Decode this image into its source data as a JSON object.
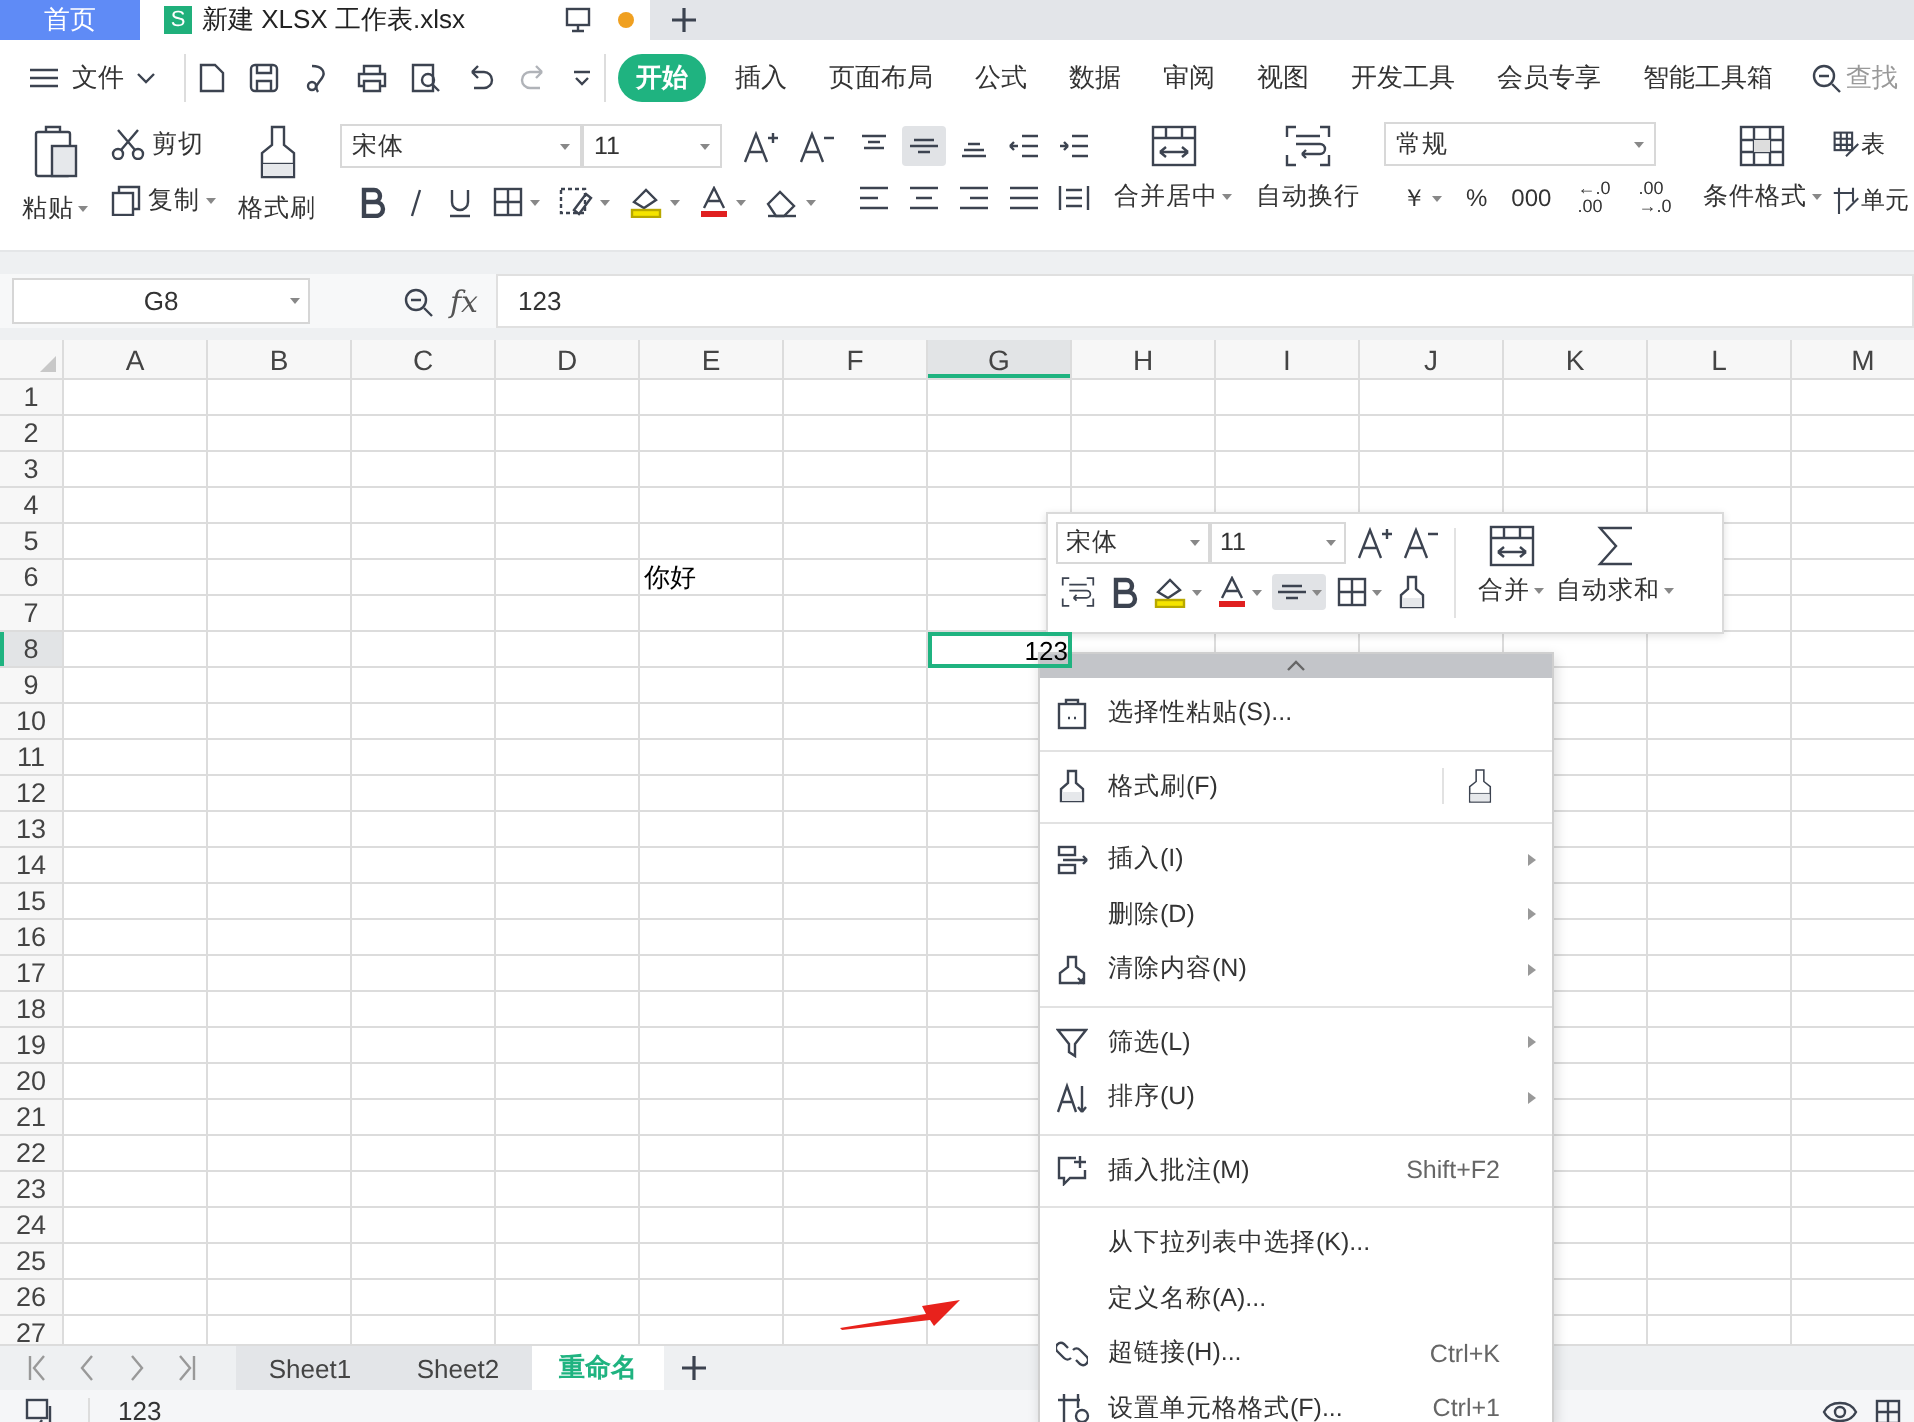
{
  "tab_bar": {
    "home_tab": "首页",
    "document_tab": {
      "badge": "S",
      "title": "新建 XLSX 工作表.xlsx",
      "unsaved": true
    }
  },
  "menu_bar": {
    "file_menu": "文件",
    "tabs": [
      {
        "label": "开始",
        "selected": true
      },
      {
        "label": "插入",
        "selected": false
      },
      {
        "label": "页面布局",
        "selected": false
      },
      {
        "label": "公式",
        "selected": false
      },
      {
        "label": "数据",
        "selected": false
      },
      {
        "label": "审阅",
        "selected": false
      },
      {
        "label": "视图",
        "selected": false
      },
      {
        "label": "开发工具",
        "selected": false
      },
      {
        "label": "会员专享",
        "selected": false
      },
      {
        "label": "智能工具箱",
        "selected": false
      }
    ],
    "search": "查找"
  },
  "ribbon": {
    "paste": "粘贴",
    "cut": "剪切",
    "copy": "复制",
    "format_painter": "格式刷",
    "font_name": "宋体",
    "font_size": "11",
    "vertical_align": [
      {
        "selected": false
      },
      {
        "selected": true
      },
      {
        "selected": false
      }
    ],
    "merge_center": "合并居中",
    "wrap_text": "自动换行",
    "number_format": "常规",
    "currency": "￥",
    "percent": "%",
    "thousands": "000",
    "increase_decimal": [
      "←.0",
      ".00"
    ],
    "decrease_decimal": [
      ".00",
      "→.0"
    ],
    "conditional_format": "条件格式",
    "table_style": "表",
    "cell_style": "单元"
  },
  "formula_bar": {
    "name_box": "G8",
    "function_label": "fx",
    "value": "123"
  },
  "sheet": {
    "columns": [
      {
        "label": "A",
        "selected": false
      },
      {
        "label": "B",
        "selected": false
      },
      {
        "label": "C",
        "selected": false
      },
      {
        "label": "D",
        "selected": false
      },
      {
        "label": "E",
        "selected": false
      },
      {
        "label": "F",
        "selected": false
      },
      {
        "label": "G",
        "selected": true
      },
      {
        "label": "H",
        "selected": false
      },
      {
        "label": "I",
        "selected": false
      },
      {
        "label": "J",
        "selected": false
      },
      {
        "label": "K",
        "selected": false
      },
      {
        "label": "L",
        "selected": false
      },
      {
        "label": "M",
        "selected": false
      }
    ],
    "rows": [
      {
        "label": "1",
        "selected": false
      },
      {
        "label": "2",
        "selected": false
      },
      {
        "label": "3",
        "selected": false
      },
      {
        "label": "4",
        "selected": false
      },
      {
        "label": "5",
        "selected": false
      },
      {
        "label": "6",
        "selected": false,
        "cells": [
          null,
          null,
          null,
          null,
          {
            "value": "你好",
            "selected": false
          }
        ]
      },
      {
        "label": "7",
        "selected": false
      },
      {
        "label": "8",
        "selected": true,
        "cells": [
          null,
          null,
          null,
          null,
          null,
          null,
          {
            "value": "123",
            "selected": true
          }
        ]
      },
      {
        "label": "9",
        "selected": false
      },
      {
        "label": "10",
        "selected": false
      },
      {
        "label": "11",
        "selected": false
      },
      {
        "label": "12",
        "selected": false
      },
      {
        "label": "13",
        "selected": false
      },
      {
        "label": "14",
        "selected": false
      },
      {
        "label": "15",
        "selected": false
      },
      {
        "label": "16",
        "selected": false
      },
      {
        "label": "17",
        "selected": false
      },
      {
        "label": "18",
        "selected": false
      },
      {
        "label": "19",
        "selected": false
      },
      {
        "label": "20",
        "selected": false
      },
      {
        "label": "21",
        "selected": false
      },
      {
        "label": "22",
        "selected": false
      },
      {
        "label": "23",
        "selected": false
      },
      {
        "label": "24",
        "selected": false
      },
      {
        "label": "25",
        "selected": false
      },
      {
        "label": "26",
        "selected": false
      },
      {
        "label": "27",
        "selected": false
      }
    ]
  },
  "mini_toolbar": {
    "font_name": "宋体",
    "font_size": "11",
    "align_selected": true,
    "merge": "合并",
    "autosum": "自动求和"
  },
  "context_menu": {
    "groups": [
      [
        {
          "label": "选择性粘贴(S)...",
          "submenu": false
        }
      ],
      [
        {
          "label": "格式刷(F)",
          "submenu": false
        }
      ],
      [
        {
          "label": "插入(I)",
          "submenu": true
        },
        {
          "label": "删除(D)",
          "submenu": true
        },
        {
          "label": "清除内容(N)",
          "submenu": true
        }
      ],
      [
        {
          "label": "筛选(L)",
          "submenu": true
        },
        {
          "label": "排序(U)",
          "submenu": true
        }
      ],
      [
        {
          "label": "插入批注(M)",
          "shortcut": "Shift+F2",
          "submenu": false
        }
      ],
      [
        {
          "label": "从下拉列表中选择(K)...",
          "submenu": false
        },
        {
          "label": "定义名称(A)...",
          "submenu": false
        },
        {
          "label": "超链接(H)...",
          "shortcut": "Ctrl+K",
          "submenu": false
        },
        {
          "label": "设置单元格格式(F)...",
          "shortcut": "Ctrl+1",
          "submenu": false
        }
      ]
    ]
  },
  "sheet_tabs": {
    "tabs": [
      {
        "label": "Sheet1",
        "selected": false
      },
      {
        "label": "Sheet2",
        "selected": false
      },
      {
        "label": "重命名",
        "selected": true
      }
    ]
  },
  "status_bar": {
    "value": "123"
  }
}
